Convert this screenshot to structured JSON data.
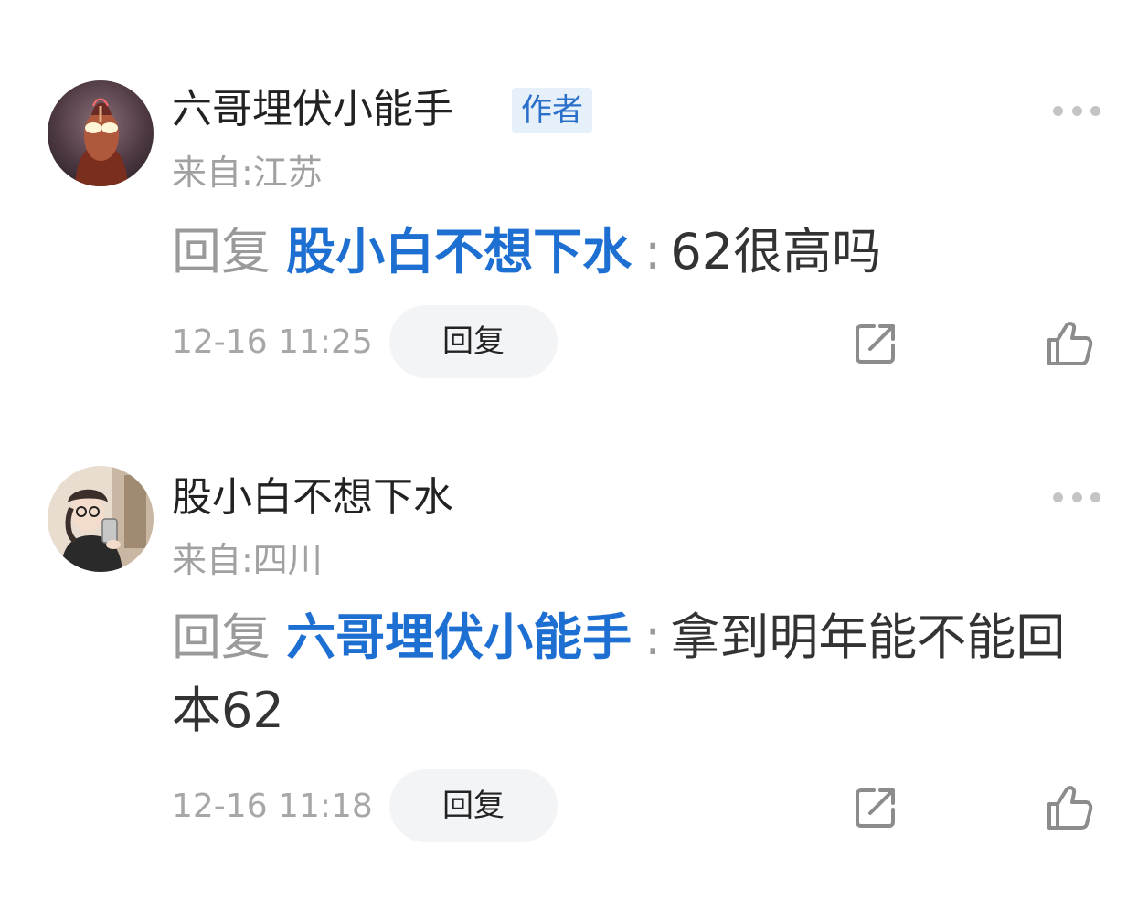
{
  "comments": [
    {
      "username": "六哥埋伏小能手",
      "badge": "作者",
      "location": "来自:江苏",
      "reply_prefix": "回复",
      "mention": "股小白不想下水",
      "colon": ":",
      "text": "62很高吗",
      "time": "12-16 11:25",
      "reply_label": "回复",
      "avatar_icon": "avatar-ultraman-icon"
    },
    {
      "username": "股小白不想下水",
      "location": "来自:四川",
      "reply_prefix": "回复",
      "mention": "六哥埋伏小能手",
      "colon": ":",
      "text": "拿到明年能不能回本62",
      "time": "12-16 11:18",
      "reply_label": "回复",
      "avatar_icon": "avatar-girl-selfie-icon"
    }
  ],
  "colors": {
    "mention": "#1d6fd2",
    "badge_bg": "#e6f0fb",
    "badge_text": "#2a6fc9",
    "muted": "#a1a1a1"
  }
}
